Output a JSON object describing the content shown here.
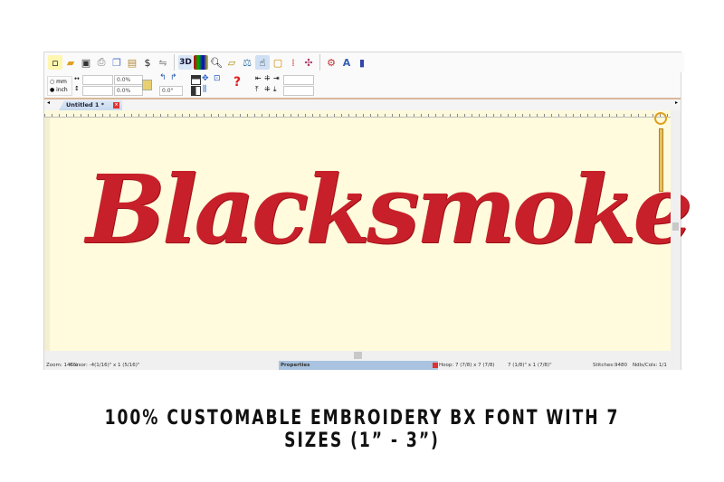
{
  "toolbar": {
    "icons": [
      "new-icon",
      "open-icon",
      "save-icon",
      "print-icon",
      "copy-icon",
      "paste-icon",
      "stitch-icon",
      "convert-icon",
      "3d-icon",
      "colors-icon",
      "zoom-icon",
      "ruler-icon",
      "balance-icon",
      "select-icon",
      "hoop-icon",
      "thread-icon",
      "pattern-icon",
      "settings-icon",
      "text-icon",
      "fill-icon"
    ],
    "label_3d": "3D"
  },
  "units": {
    "mm": "mm",
    "inch": "inch",
    "selected": "inch"
  },
  "size": {
    "width": "",
    "height": "",
    "scale_x": "0.0%",
    "scale_y": "0.0%",
    "rotation": "0.0°"
  },
  "tab": {
    "title": "Untitled 1 *"
  },
  "canvas": {
    "design_text": "Blacksmoke",
    "thread_color": "#c8202a",
    "background": "#fffbdc"
  },
  "status": {
    "zoom": "Zoom: 146%",
    "cursor": "Cursor: -4(1/16)\" x 1 (5/16)\"",
    "properties": "Properties",
    "hoop": "Hoop: 7 (7/8) x 7 (7/8)",
    "design_size": "7 (1/8)\" x 1 (7/8)\"",
    "stitches": "Stitches:9480",
    "ndls": "Ndls/Cols: 1/1"
  },
  "caption": "100% CUSTOMABLE EMBROIDERY BX FONT WITH 7 SIZES (1” -  3”)"
}
